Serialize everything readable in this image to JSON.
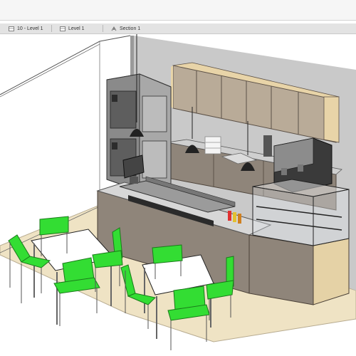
{
  "tabs": [
    {
      "label": "10 - Level 1",
      "icon": "floor-plan-icon"
    },
    {
      "label": "Level 1",
      "icon": "floor-plan-icon"
    },
    {
      "label": "Section 1",
      "icon": "section-view-icon"
    }
  ],
  "colors": {
    "floor": "#efe3c4",
    "wall": "#c8c8c8",
    "cabinet": "#8f857a",
    "upper_cabinet": "#b8aa97",
    "chair": "#33dd33",
    "table_top": "#ffffff"
  }
}
